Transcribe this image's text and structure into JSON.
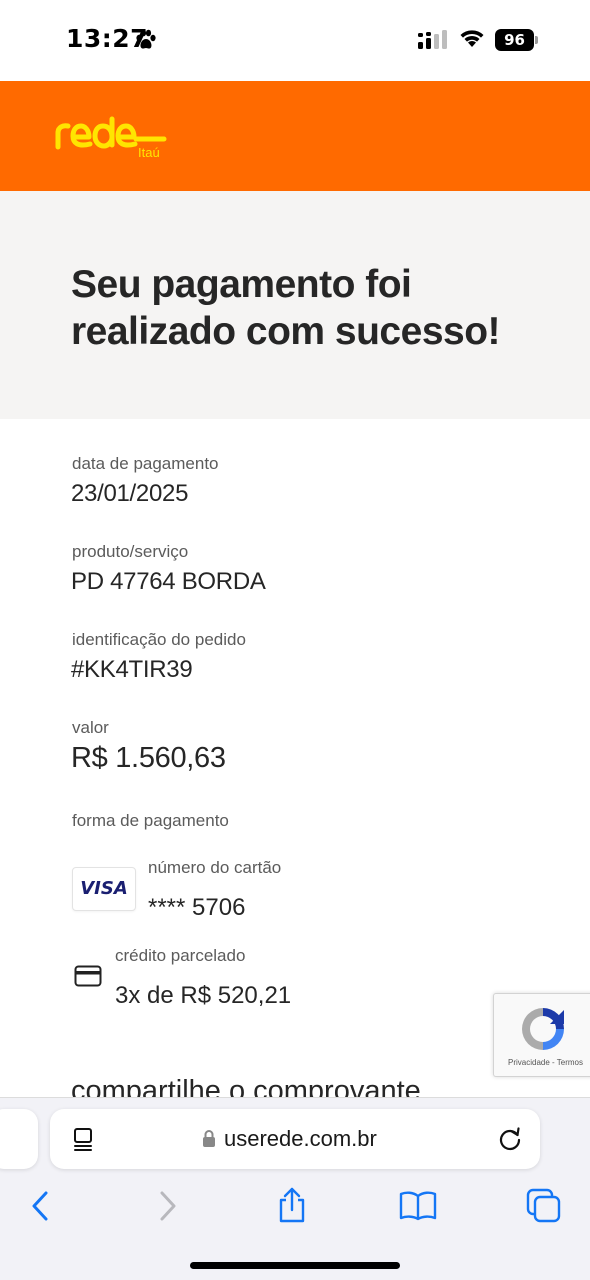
{
  "status_bar": {
    "time": "13:27",
    "battery": "96",
    "icons": [
      "paw-icon",
      "signal-icon",
      "wifi-icon",
      "battery-icon"
    ]
  },
  "header": {
    "logo_text": "rede",
    "logo_sub": "Itaú",
    "brand_color": "#ff6a00",
    "logo_color": "#ffe500"
  },
  "hero": {
    "title": "Seu pagamento foi realizado com sucesso!"
  },
  "details": {
    "payment_date_label": "data de pagamento",
    "payment_date": "23/01/2025",
    "product_label": "produto/serviço",
    "product": "PD 47764 BORDA",
    "order_id_label": "identificação do pedido",
    "order_id": "#KK4TIR39",
    "amount_label": "valor",
    "amount": "R$ 1.560,63",
    "payment_method_label": "forma de pagamento",
    "card_brand": "VISA",
    "card_number_label": "número do cartão",
    "card_number": "**** 5706",
    "installment_label": "crédito parcelado",
    "installment": "3x de R$ 520,21",
    "share_title": "compartilhe o comprovante"
  },
  "recaptcha": {
    "links": "Privacidade - Termos"
  },
  "browser": {
    "url": "userede.com.br",
    "toolbar": [
      "back-icon",
      "forward-icon",
      "share-icon",
      "bookmarks-icon",
      "tabs-icon"
    ]
  }
}
